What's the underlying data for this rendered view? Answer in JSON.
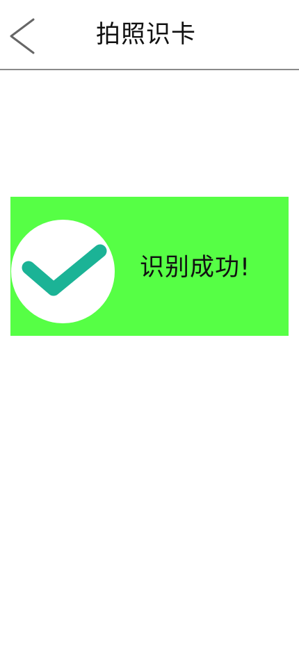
{
  "header": {
    "back_icon": "chevron-left-icon",
    "title": "拍照识卡"
  },
  "result": {
    "text": "识别成功!",
    "icon": "check-icon",
    "banner_color": "#56ff45",
    "check_color": "#1bb396",
    "circle_color": "#ffffff"
  },
  "colors": {
    "background": "#ffffff",
    "divider": "#8a8a8a",
    "text": "#111111"
  }
}
